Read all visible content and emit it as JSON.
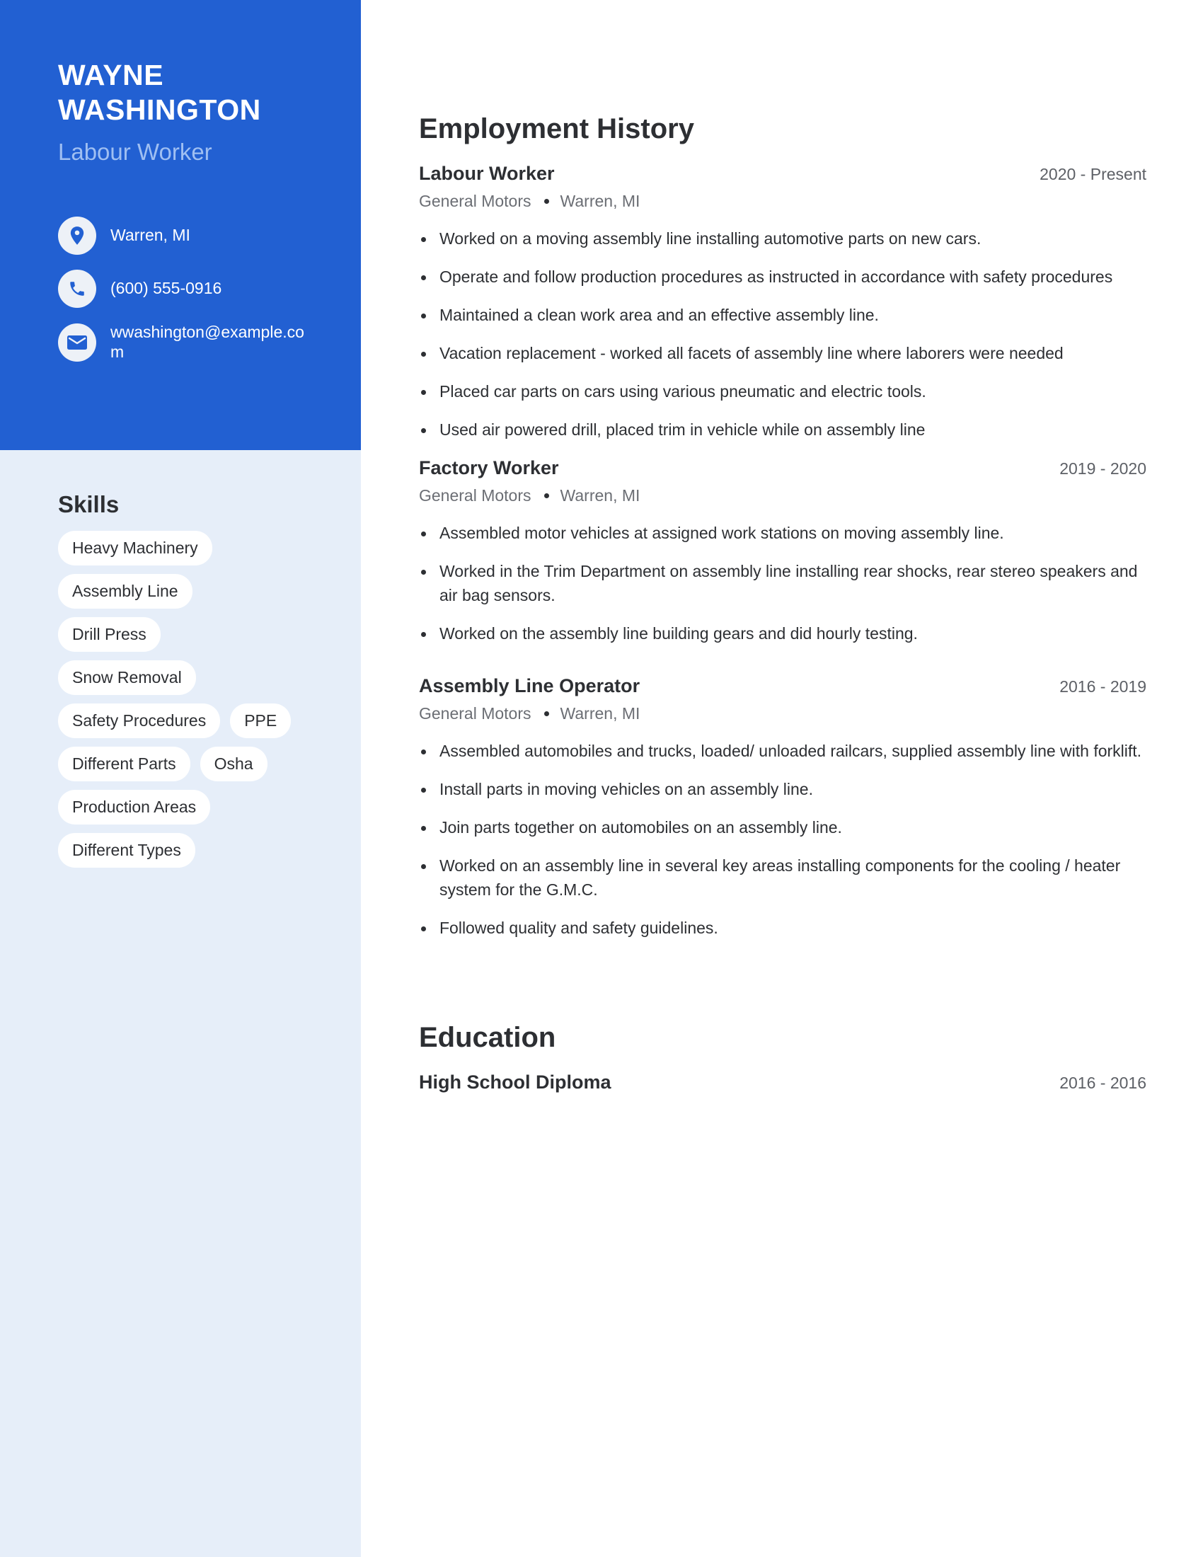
{
  "profile": {
    "name": "WAYNE WASHINGTON",
    "headline": "Labour Worker",
    "contacts": [
      {
        "icon": "location-pin-icon",
        "text": "Warren, MI"
      },
      {
        "icon": "phone-icon",
        "text": "(600) 555-0916"
      },
      {
        "icon": "email-icon",
        "text": "wwashington@example.com"
      }
    ]
  },
  "skills": {
    "title": "Skills",
    "items": [
      "Heavy Machinery",
      "Assembly Line",
      "Drill Press",
      "Snow Removal",
      "Safety Procedures",
      "PPE",
      "Different Parts",
      "Osha",
      "Production Areas",
      "Different Types"
    ]
  },
  "employment": {
    "title": "Employment History",
    "jobs": [
      {
        "title": "Labour Worker",
        "dates": "2020 - Present",
        "company": "General Motors",
        "location": "Warren, MI",
        "bullets": [
          "Worked on a moving assembly line installing automotive parts on new cars.",
          "Operate and follow production procedures as instructed in accordance with safety procedures",
          "Maintained a clean work area and an effective assembly line.",
          "Vacation replacement - worked all facets of assembly line where laborers were needed",
          "Placed car parts on cars using various pneumatic and electric tools.",
          "Used air powered drill, placed trim in vehicle while on assembly line"
        ]
      },
      {
        "title": "Factory Worker",
        "dates": "2019 - 2020",
        "company": "General Motors",
        "location": "Warren, MI",
        "bullets": [
          "Assembled motor vehicles at assigned work stations on moving assembly line.",
          "Worked in the Trim Department on assembly line installing rear shocks, rear stereo speakers and air bag sensors.",
          "Worked on the assembly line building gears and did hourly testing."
        ]
      },
      {
        "title": "Assembly Line Operator",
        "dates": "2016 - 2019",
        "company": "General Motors",
        "location": "Warren, MI",
        "bullets": [
          "Assembled automobiles and trucks, loaded/ unloaded railcars, supplied assembly line with forklift.",
          "Install parts in moving vehicles on an assembly line.",
          "Join parts together on automobiles on an assembly line.",
          "Worked on an assembly line in several key areas installing components for the cooling / heater system for the G.M.C.",
          "Followed quality and safety guidelines."
        ]
      }
    ]
  },
  "education": {
    "title": "Education",
    "items": [
      {
        "degree": "High School Diploma",
        "dates": "2016 - 2016"
      }
    ]
  },
  "colors": {
    "accent": "#2260d2",
    "sidebar_bg": "#e6eef9",
    "headline": "#9fbff2",
    "text": "#2d2f33"
  }
}
